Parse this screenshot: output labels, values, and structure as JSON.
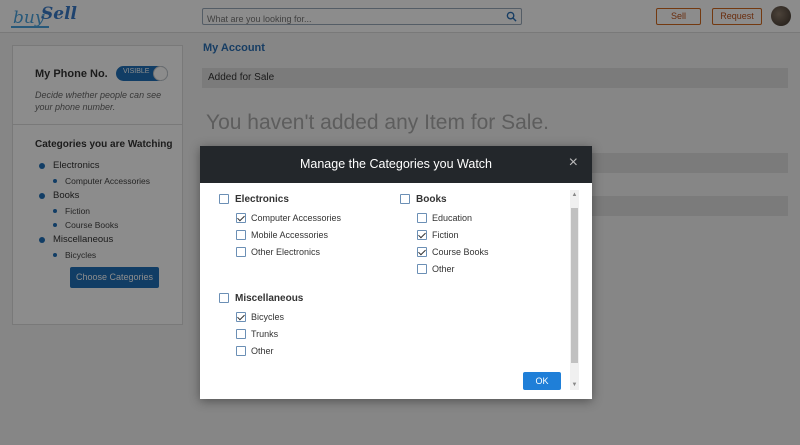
{
  "header": {
    "logo_buy": "buy",
    "logo_sell": "Sell",
    "search_placeholder": "What are you looking for...",
    "sell_label": "Sell",
    "request_label": "Request"
  },
  "sidebar": {
    "phone_label": "My Phone No.",
    "toggle_label": "VISIBLE",
    "phone_desc": "Decide whether people can see your phone number.",
    "watch_title": "Categories you are Watching",
    "watch": [
      {
        "label": "Electronics",
        "children": [
          "Computer Accessories"
        ]
      },
      {
        "label": "Books",
        "children": [
          "Fiction",
          "Course Books"
        ]
      },
      {
        "label": "Miscellaneous",
        "children": [
          "Bicycles"
        ]
      }
    ],
    "choose_label": "Choose Categories"
  },
  "main": {
    "title": "My Account",
    "section_added": "Added for Sale",
    "empty_message": "You haven't added any Item for Sale."
  },
  "modal": {
    "title": "Manage the Categories you Watch",
    "close_glyph": "×",
    "ok_label": "OK",
    "groups": [
      {
        "label": "Electronics",
        "checked": false,
        "options": [
          {
            "label": "Computer Accessories",
            "checked": true
          },
          {
            "label": "Mobile Accessories",
            "checked": false
          },
          {
            "label": "Other Electronics",
            "checked": false
          }
        ]
      },
      {
        "label": "Books",
        "checked": false,
        "options": [
          {
            "label": "Education",
            "checked": false
          },
          {
            "label": "Fiction",
            "checked": true
          },
          {
            "label": "Course Books",
            "checked": true
          },
          {
            "label": "Other",
            "checked": false
          }
        ]
      },
      {
        "label": "Miscellaneous",
        "checked": false,
        "options": [
          {
            "label": "Bicycles",
            "checked": true
          },
          {
            "label": "Trunks",
            "checked": false
          },
          {
            "label": "Other",
            "checked": false
          }
        ]
      }
    ]
  },
  "colors": {
    "accent": "#1f6fb8",
    "header_button": "#c0521a",
    "modal_header": "#23272b"
  }
}
